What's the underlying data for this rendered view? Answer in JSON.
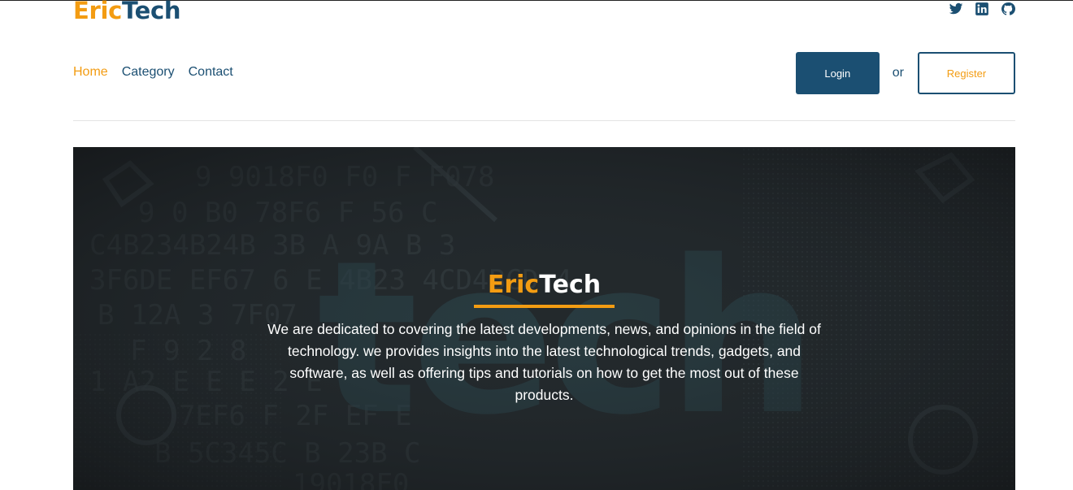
{
  "brand": {
    "part1": "Eric",
    "part2": "Tech"
  },
  "social": [
    {
      "icon": "twitter-icon"
    },
    {
      "icon": "linkedin-icon"
    },
    {
      "icon": "github-icon"
    }
  ],
  "nav": {
    "home": "Home",
    "category": "Category",
    "contact": "Contact"
  },
  "auth": {
    "login_label": "Login",
    "or_label": "or",
    "register_label": "Register"
  },
  "hero": {
    "title_part1": "Eric",
    "title_part2": "Tech",
    "description": "We are dedicated to covering the latest developments, news, and opinions in the field of technology. we provides insights into the latest technological trends, gadgets, and software, as well as offering tips and tutorials on how to get the most out of these products.",
    "background_word": "tech"
  },
  "colors": {
    "primary": "#1b4f72",
    "accent": "#f39c12",
    "hero_bg": "#1f2326"
  }
}
